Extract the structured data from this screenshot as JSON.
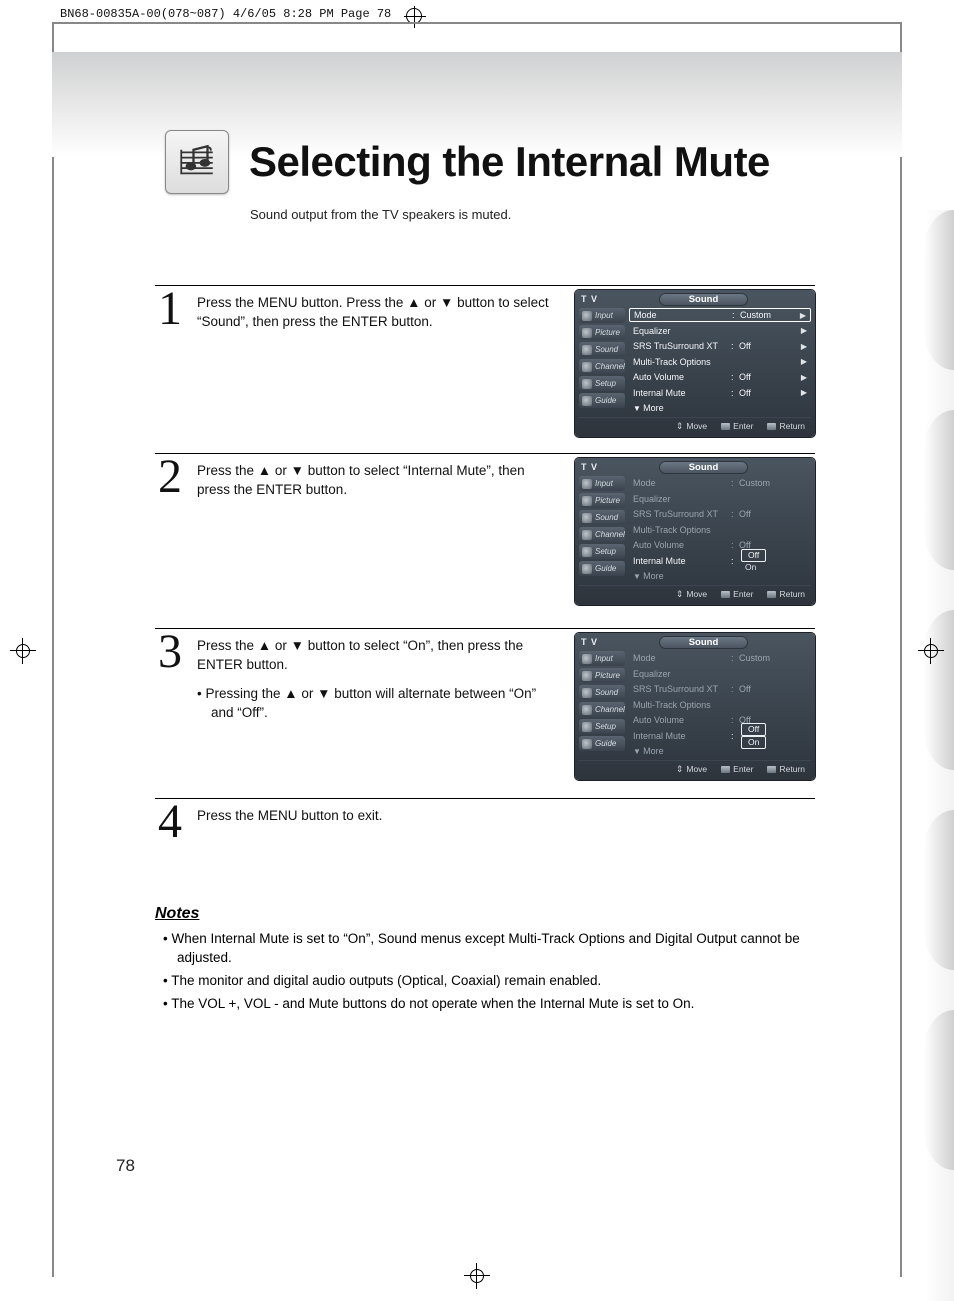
{
  "header": {
    "print_line": "BN68-00835A-00(078~087)  4/6/05  8:28 PM  Page 78",
    "title": "Selecting the Internal Mute",
    "subtitle": "Sound output from the TV speakers is muted."
  },
  "steps": [
    {
      "num": "1",
      "text": "Press the MENU button. Press the ▲ or ▼ button to select “Sound”, then press the ENTER button.",
      "osd": {
        "tv": "T V",
        "title": "Sound",
        "tabs": [
          "Input",
          "Picture",
          "Sound",
          "Channel",
          "Setup",
          "Guide"
        ],
        "rows": [
          {
            "label": "Mode",
            "value": "Custom",
            "arrow": true,
            "selected": true
          },
          {
            "label": "Equalizer",
            "value": "",
            "arrow": true
          },
          {
            "label": "SRS TruSurround XT",
            "value": "Off",
            "arrow": true
          },
          {
            "label": "Multi-Track Options",
            "value": "",
            "arrow": true
          },
          {
            "label": "Auto Volume",
            "value": "Off",
            "arrow": true
          },
          {
            "label": "Internal Mute",
            "value": "Off",
            "arrow": true
          },
          {
            "label": "More",
            "more": true
          }
        ],
        "foot": {
          "move": "Move",
          "enter": "Enter",
          "ret": "Return"
        }
      }
    },
    {
      "num": "2",
      "text": "Press the ▲ or ▼ button to select “Internal Mute”, then press the ENTER button.",
      "osd": {
        "tv": "T V",
        "title": "Sound",
        "tabs": [
          "Input",
          "Picture",
          "Sound",
          "Channel",
          "Setup",
          "Guide"
        ],
        "rows": [
          {
            "label": "Mode",
            "value": "Custom",
            "dim": true
          },
          {
            "label": "Equalizer",
            "value": "",
            "dim": true
          },
          {
            "label": "SRS TruSurround XT",
            "value": "Off",
            "dim": true
          },
          {
            "label": "Multi-Track Options",
            "value": "",
            "dim": true
          },
          {
            "label": "Auto Volume",
            "value": "Off",
            "dim": true
          },
          {
            "label": "Internal Mute",
            "options": [
              "Off",
              "On"
            ],
            "selected_option": 0
          },
          {
            "label": "More",
            "more": true,
            "dim": true
          }
        ],
        "foot": {
          "move": "Move",
          "enter": "Enter",
          "ret": "Return"
        }
      }
    },
    {
      "num": "3",
      "text": "Press the ▲ or ▼ button to select “On”, then press the ENTER button.",
      "bullets": [
        "Pressing the ▲ or ▼ button will alternate between “On” and “Off”."
      ],
      "osd": {
        "tv": "T V",
        "title": "Sound",
        "tabs": [
          "Input",
          "Picture",
          "Sound",
          "Channel",
          "Setup",
          "Guide"
        ],
        "rows": [
          {
            "label": "Mode",
            "value": "Custom",
            "dim": true
          },
          {
            "label": "Equalizer",
            "value": "",
            "dim": true
          },
          {
            "label": "SRS TruSurround XT",
            "value": "Off",
            "dim": true
          },
          {
            "label": "Multi-Track Options",
            "value": "",
            "dim": true
          },
          {
            "label": "Auto Volume",
            "value": "Off",
            "dim": true
          },
          {
            "label": "Internal Mute",
            "options": [
              "Off",
              "On"
            ],
            "selected_option": 0,
            "dim_label": true
          },
          {
            "label": "More",
            "more": true,
            "dim": true
          }
        ],
        "foot": {
          "move": "Move",
          "enter": "Enter",
          "ret": "Return"
        }
      }
    },
    {
      "num": "4",
      "text": "Press the MENU button to exit."
    }
  ],
  "notes": {
    "heading": "Notes",
    "items": [
      "When Internal Mute is set to “On”, Sound menus except Multi-Track Options and Digital Output cannot be adjusted.",
      "The monitor and digital audio outputs (Optical, Coaxial) remain enabled.",
      "The VOL +, VOL - and Mute buttons do not operate when the Internal Mute is set to On."
    ]
  },
  "page_number": "78"
}
